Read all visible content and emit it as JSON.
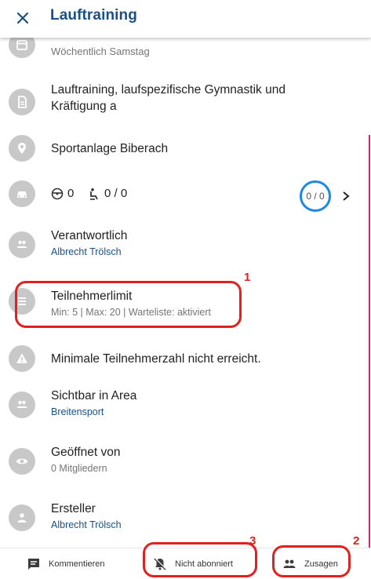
{
  "header": {
    "title": "Lauftraining"
  },
  "details": {
    "recurrence": "Wöchentlich Samstag",
    "description": "Lauftraining, laufspezifische Gymnastik und Kräftigung a",
    "location": "Sportanlage Biberach",
    "carpool": {
      "drivers": "0",
      "passengers": "0 / 0",
      "ring_value": "0 / 0"
    },
    "responsible": {
      "label": "Verantwortlich",
      "value": "Albrecht Trölsch"
    },
    "participant_limit": {
      "label": "Teilnehmerlimit",
      "value": "Min: 5 | Max: 20 | Warteliste: aktiviert"
    },
    "warning": "Minimale Teilnehmerzahl nicht erreicht.",
    "visible_in": {
      "label": "Sichtbar in Area",
      "value": "Breitensport"
    },
    "opened_by": {
      "label": "Geöffnet von",
      "value": "0 Mitgliedern"
    },
    "creator": {
      "label": "Ersteller",
      "value": "Albrecht Trölsch"
    }
  },
  "bottom_bar": {
    "comment_label": "Kommentieren",
    "subscribe_label": "Nicht abonniert",
    "accept_label": "Zusagen"
  },
  "annotations": [
    "1",
    "2",
    "3"
  ],
  "colors": {
    "accent": "#1a4f87",
    "icon_circle": "#c8c8c8",
    "annotation": "#e32020",
    "ring": "#1e88e5",
    "scroll_indicator": "#e91e63"
  }
}
